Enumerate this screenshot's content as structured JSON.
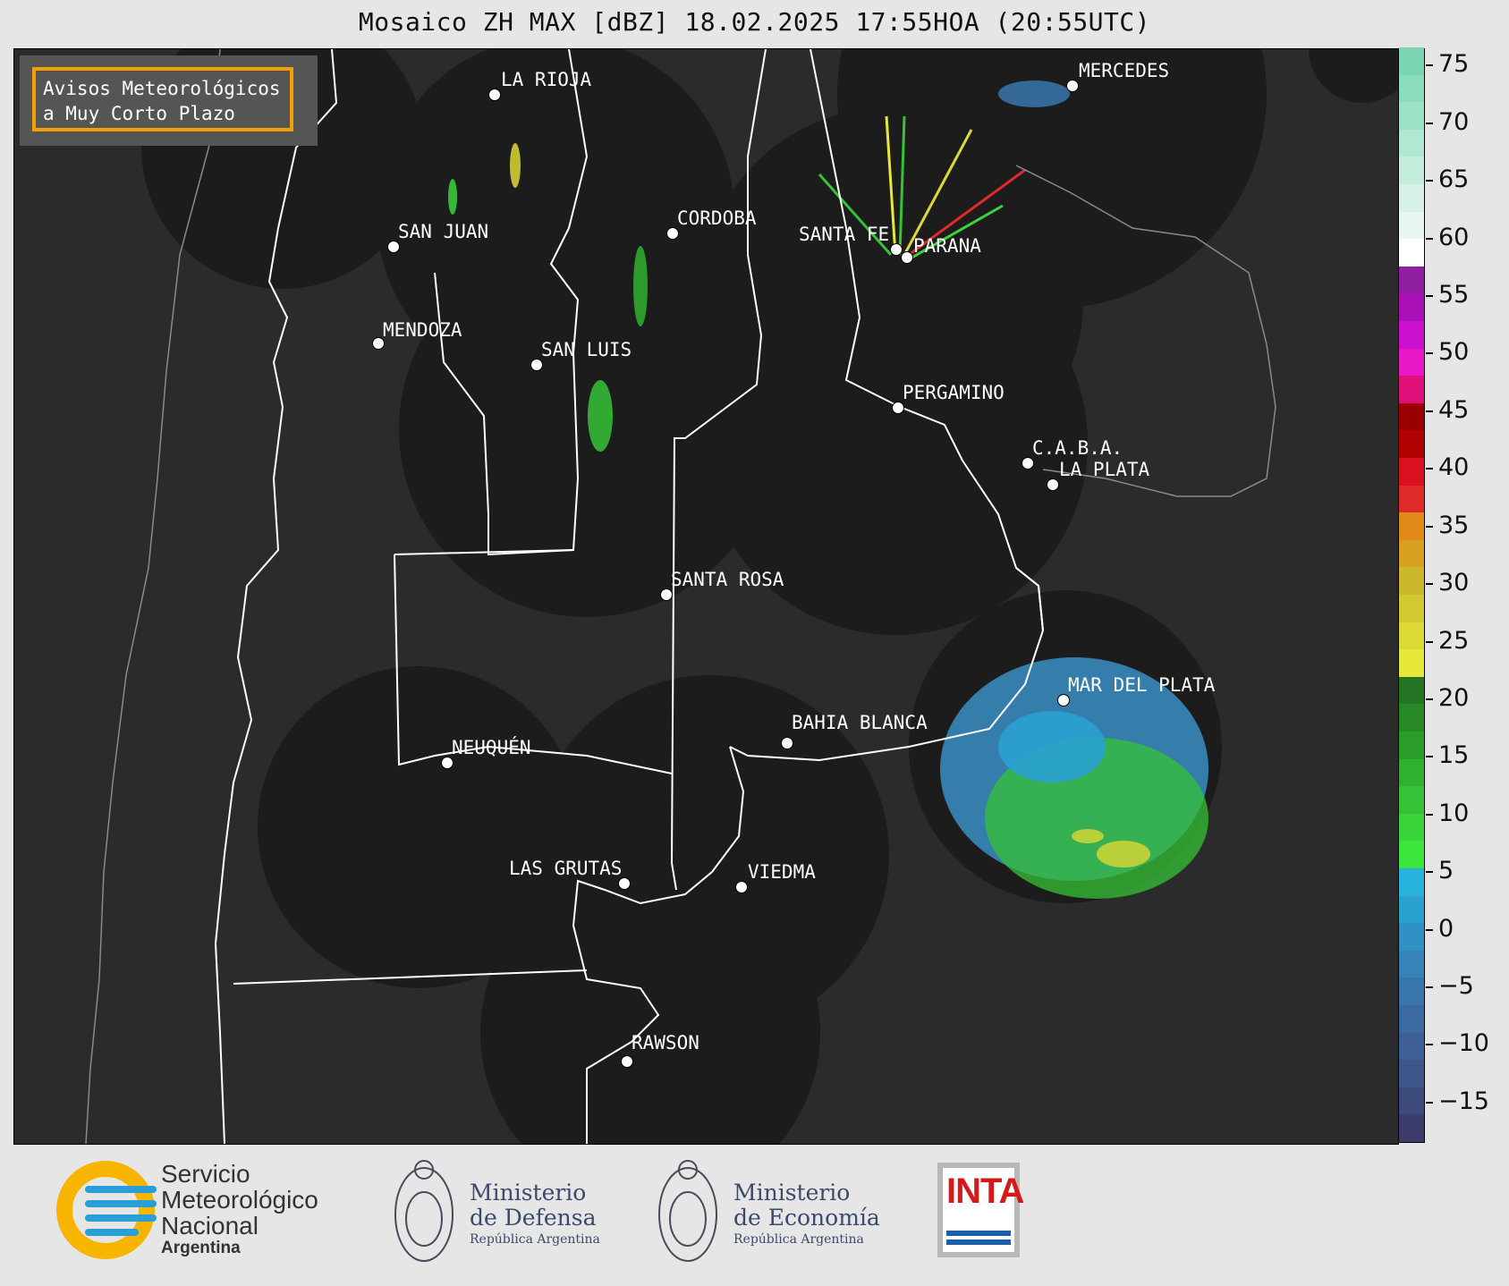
{
  "title": "Mosaico ZH MAX [dBZ] 18.02.2025 17:55HOA (20:55UTC)",
  "warning": {
    "line1": "Avisos Meteorológicos",
    "line2": "a Muy Corto Plazo",
    "border_color": "#f5a000"
  },
  "cities": [
    {
      "name": "LA RIOJA"
    },
    {
      "name": "MERCEDES"
    },
    {
      "name": "SAN JUAN"
    },
    {
      "name": "CORDOBA"
    },
    {
      "name": "SANTA FE"
    },
    {
      "name": "PARANA"
    },
    {
      "name": "MENDOZA"
    },
    {
      "name": "SAN LUIS"
    },
    {
      "name": "PERGAMINO"
    },
    {
      "name": "C.A.B.A."
    },
    {
      "name": "LA PLATA"
    },
    {
      "name": "SANTA ROSA"
    },
    {
      "name": "MAR DEL PLATA"
    },
    {
      "name": "BAHIA BLANCA"
    },
    {
      "name": "NEUQUÉN"
    },
    {
      "name": "LAS GRUTAS"
    },
    {
      "name": "VIEDMA"
    },
    {
      "name": "RAWSON"
    }
  ],
  "colorbar": {
    "unit": "dBZ",
    "ticks": [
      "75",
      "70",
      "65",
      "60",
      "55",
      "50",
      "45",
      "40",
      "35",
      "30",
      "25",
      "20",
      "15",
      "10",
      "5",
      "0",
      "−5",
      "−10",
      "−15"
    ],
    "colors": [
      "#3b3c6c",
      "#3d4a7c",
      "#3e568a",
      "#3e5f95",
      "#3b6aa0",
      "#3876ac",
      "#3583b8",
      "#2f91c4",
      "#2aa2d0",
      "#28b3dc",
      "#3ce63c",
      "#3ad43a",
      "#36c236",
      "#2fb02f",
      "#2a9c2a",
      "#268826",
      "#237523",
      "#e8e83a",
      "#dcd834",
      "#d2c830",
      "#ccb82c",
      "#d8a020",
      "#e08818",
      "#e02a2a",
      "#d81020",
      "#b00000",
      "#9a0000",
      "#e0107a",
      "#e818c8",
      "#cc10d0",
      "#aa10b8",
      "#901ea0",
      "#ffffff",
      "#e8f6f0",
      "#d6f2e6",
      "#c4eedc",
      "#b0e8d2",
      "#9ce2c6",
      "#8adcbc",
      "#7ad6b2"
    ]
  },
  "logos": {
    "smn_line1": "Servicio",
    "smn_line2": "Meteorológico",
    "smn_line3": "Nacional",
    "smn_line4": "Argentina",
    "defensa_line1": "Ministerio",
    "defensa_line2": "de Defensa",
    "defensa_line3": "República Argentina",
    "economia_line1": "Ministerio",
    "economia_line2": "de Economía",
    "economia_line3": "República Argentina",
    "inta": "INTA"
  }
}
